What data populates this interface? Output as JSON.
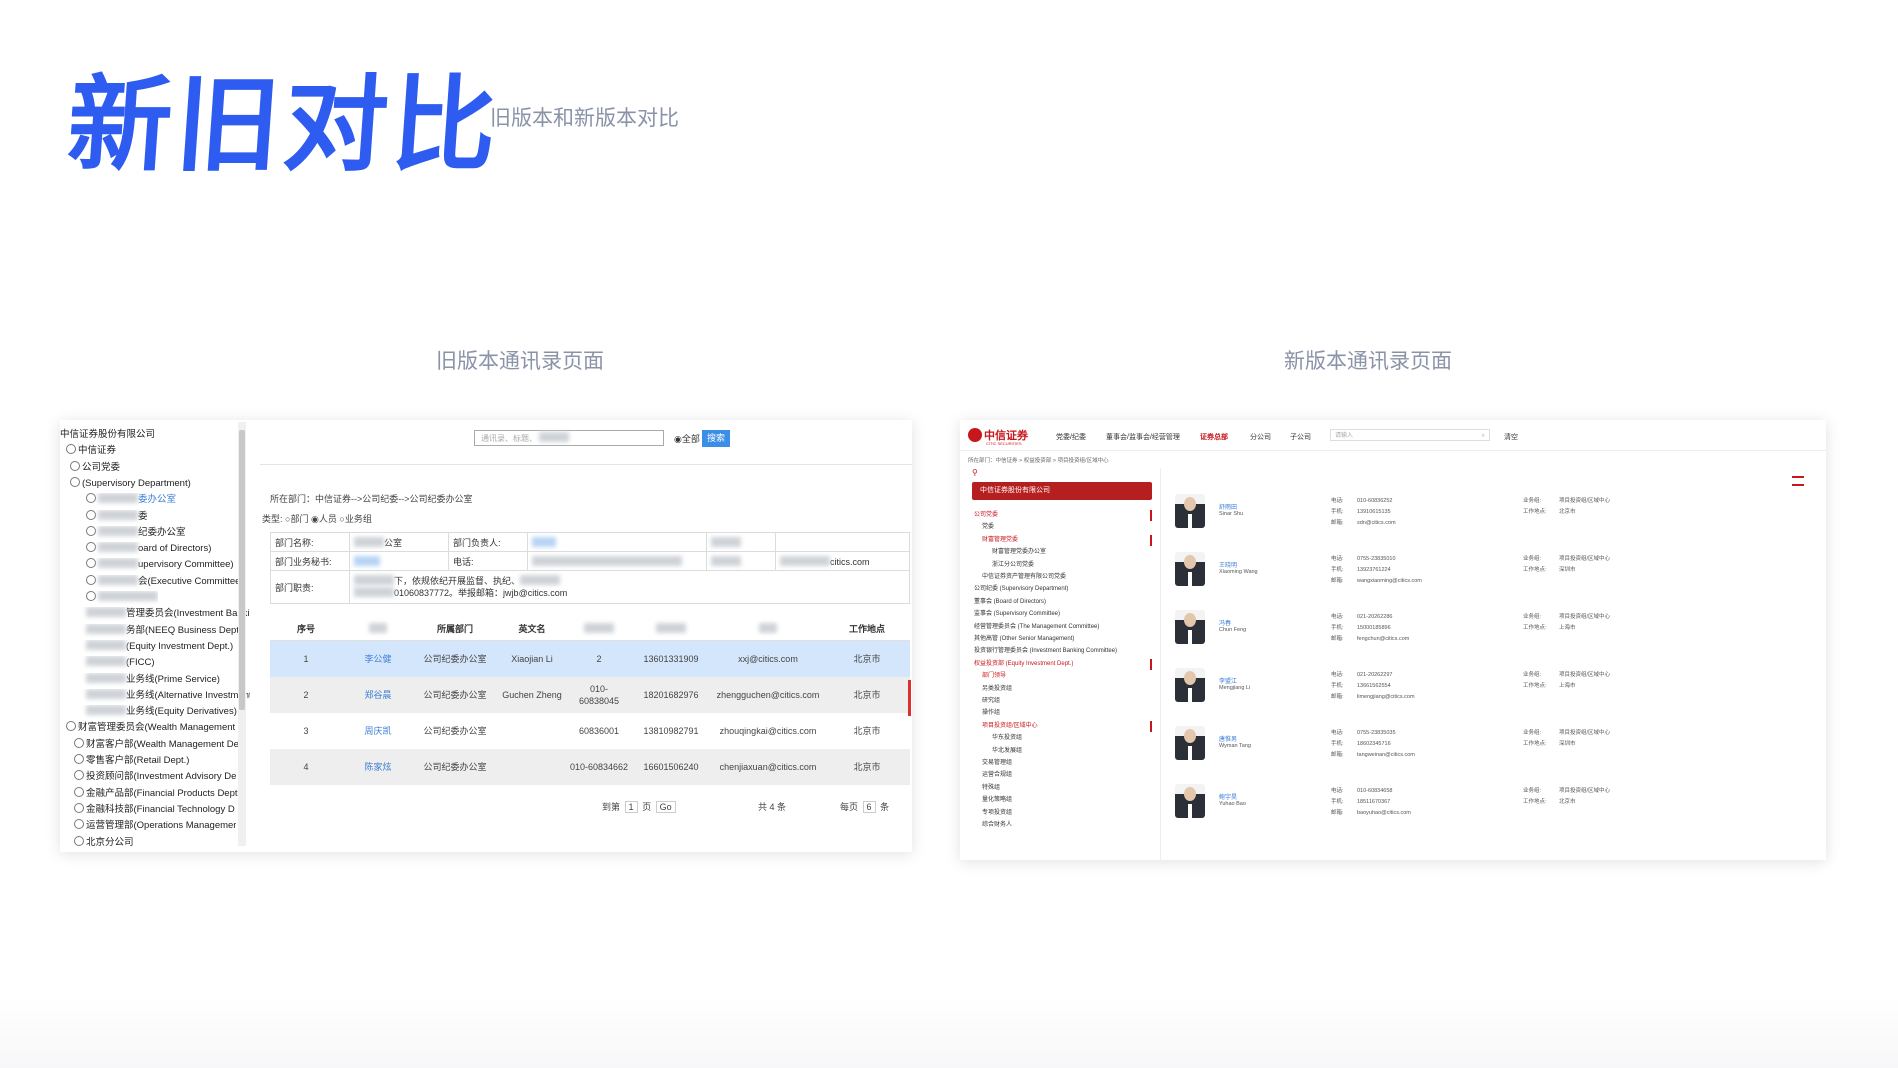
{
  "page": {
    "title": "新旧对比",
    "subtitle": "旧版本和新版本对比"
  },
  "captions": {
    "old": "旧版本通讯录页面",
    "new": "新版本通讯录页面"
  },
  "colors": {
    "accent": "#2e5cf0",
    "caption": "#8a93a8",
    "brand_red": "#c8161d",
    "link": "#3d7fd6",
    "old_button": "#3b8ee8"
  },
  "old": {
    "tree": [
      "中信证券股份有限公司",
      "中信证券",
      "公司党委",
      "(Supervisory Department)",
      "委办公室",
      "委",
      "纪委办公室",
      "oard of Directors)",
      "upervisory Committee)",
      "会(Executive Committee)",
      "",
      "管理委员会(Investment Banki",
      "务部(NEEQ Business Dept.)",
      "(Equity Investment Dept.)",
      "(FICC)",
      "业务线(Prime Service)",
      "业务线(Alternative Investment",
      "业务线(Equity Derivatives)",
      "财富管理委员会(Wealth Management C",
      "财富客户部(Wealth Management De",
      "零售客户部(Retail Dept.)",
      "投资顾问部(Investment Advisory De",
      "金融产品部(Financial Products Dept",
      "金融科技部(Financial Technology D",
      "运营管理部(Operations Managemer",
      "北京分公司"
    ],
    "search_placeholder": "通讯录、标题、",
    "scope_label": "全部",
    "search_button": "搜索",
    "breadcrumb": "所在部门：中信证券-->公司纪委-->公司纪委办公室",
    "type_label": "类型:",
    "type_options": [
      "部门",
      "人员",
      "业务组"
    ],
    "info": {
      "dept_name_label": "部门名称:",
      "dept_name_value": "公室",
      "head_label": "部门负责人:",
      "secretary_label": "部门业务秘书:",
      "phone_label": "电话:",
      "email_value": "citics.com",
      "duty_label": "部门职责:",
      "duty_value_1": "下，依规依纪开展监督、执纪、",
      "duty_value_2": "01060837772。举报邮箱：jwjb@citics.com"
    },
    "columns": {
      "seq": "序号",
      "dept": "所属部门",
      "en_name": "英文名",
      "location": "工作地点"
    },
    "rows": [
      {
        "seq": "1",
        "name": "李公健",
        "dept": "公司纪委办公室",
        "en": "Xiaojian  Li",
        "phone": "2",
        "mobile": "13601331909",
        "email": "xxj@citics.com",
        "loc": "北京市"
      },
      {
        "seq": "2",
        "name": "郑谷晨",
        "dept": "公司纪委办公室",
        "en": "Guchen  Zheng",
        "phone": "010- 60838045",
        "mobile": "18201682976",
        "email": "zhengguchen@citics.com",
        "loc": "北京市"
      },
      {
        "seq": "3",
        "name": "周庆凯",
        "dept": "公司纪委办公室",
        "en": "",
        "phone": "60836001",
        "mobile": "13810982791",
        "email": "zhouqingkai@citics.com",
        "loc": "北京市"
      },
      {
        "seq": "4",
        "name": "陈家炫",
        "dept": "公司纪委办公室",
        "en": "",
        "phone": "010-60834662",
        "mobile": "16601506240",
        "email": "chenjiaxuan@citics.com",
        "loc": "北京市"
      }
    ],
    "pager": {
      "goto_pre": "到第",
      "page": "1",
      "goto_post": "页",
      "go": "Go",
      "total": "共 4 条",
      "per_pre": "每页",
      "per": "6",
      "per_post": "条"
    }
  },
  "new": {
    "logo_cn": "中信证券",
    "logo_en": "CITIC SECURITIES",
    "nav": [
      "党委/纪委",
      "董事会/监事会/经营管理",
      "证券总部",
      "分公司",
      "子公司"
    ],
    "nav_active_index": 2,
    "search_placeholder": "请输入",
    "clear_label": "清空",
    "breadcrumb": "所在部门：中信证券 > 权益投资部 > 项目投资组/区域中心",
    "sidebar_head": "中信证券股份有限公司",
    "sidebar": [
      {
        "label": "公司党委",
        "red": true,
        "bar": true
      },
      {
        "label": "党委",
        "red": false
      },
      {
        "label": "财富管理党委",
        "red": true,
        "bar": true
      },
      {
        "label": "财富管理党委办公室",
        "red": false
      },
      {
        "label": "浙江分公司党委",
        "red": false
      },
      {
        "label": "中信证券资产管理有限公司党委",
        "red": false
      },
      {
        "label": "公司纪委 (Supervisory Department)",
        "red": false
      },
      {
        "label": "董事会 (Board of Directors)",
        "red": false
      },
      {
        "label": "监事会 (Supervisory Committee)",
        "red": false
      },
      {
        "label": "经营管理委员会 (The Management Committee)",
        "red": false
      },
      {
        "label": "其他高管 (Other Senior Management)",
        "red": false
      },
      {
        "label": "投资银行管理委员会 (Investment Banking Committee)",
        "red": false
      },
      {
        "label": "权益投资部 (Equity Investment Dept.)",
        "red": true,
        "bar": true
      },
      {
        "label": "部门领导",
        "red": true
      },
      {
        "label": "另类投资组",
        "red": false
      },
      {
        "label": "研究组",
        "red": false
      },
      {
        "label": "操作组",
        "red": false
      },
      {
        "label": "项目投资组/区域中心",
        "red": true,
        "bar": true
      },
      {
        "label": "华东投资组",
        "red": false
      },
      {
        "label": "华北发展组",
        "red": false
      },
      {
        "label": "交易管理组",
        "red": false
      },
      {
        "label": "运营合规组",
        "red": false
      },
      {
        "label": "特殊组",
        "red": false
      },
      {
        "label": "量化策略组",
        "red": false
      },
      {
        "label": "专项投资组",
        "red": false
      },
      {
        "label": "综合财务人",
        "red": false
      }
    ],
    "labels": {
      "phone": "电话:",
      "mobile": "手机:",
      "email": "邮箱:",
      "unit": "业务组:",
      "place": "工作地点:"
    },
    "people": [
      {
        "name": "舒雨田",
        "en": "Sinar Shu",
        "phone": "010-60836252",
        "mobile": "13910615135",
        "email": "sdn@citics.com",
        "unit": "项目投资组/区域中心",
        "place": "北京市"
      },
      {
        "name": "王晓明",
        "en": "Xiaoming Wang",
        "phone": "0755-23835010",
        "mobile": "13923761224",
        "email": "wangxiaoming@citics.com",
        "unit": "项目投资组/区域中心",
        "place": "深圳市"
      },
      {
        "name": "冯春",
        "en": "Chun Feng",
        "phone": "021-20262286",
        "mobile": "15000185896",
        "email": "fengchun@citics.com",
        "unit": "项目投资组/区域中心",
        "place": "上海市"
      },
      {
        "name": "李盟江",
        "en": "Mengjiang Li",
        "phone": "021-20262297",
        "mobile": "13661562554",
        "email": "limengjiang@citics.com",
        "unit": "项目投资组/区域中心",
        "place": "上海市"
      },
      {
        "name": "唐惟男",
        "en": "Wyman Tang",
        "phone": "0755-23835035",
        "mobile": "18602345716",
        "email": "tangweinan@citics.com",
        "unit": "项目投资组/区域中心",
        "place": "深圳市"
      },
      {
        "name": "鲍宇昊",
        "en": "Yuhao Bao",
        "phone": "010-60834658",
        "mobile": "18511670367",
        "email": "baoyuhao@citics.com",
        "unit": "项目投资组/区域中心",
        "place": "北京市"
      }
    ]
  }
}
